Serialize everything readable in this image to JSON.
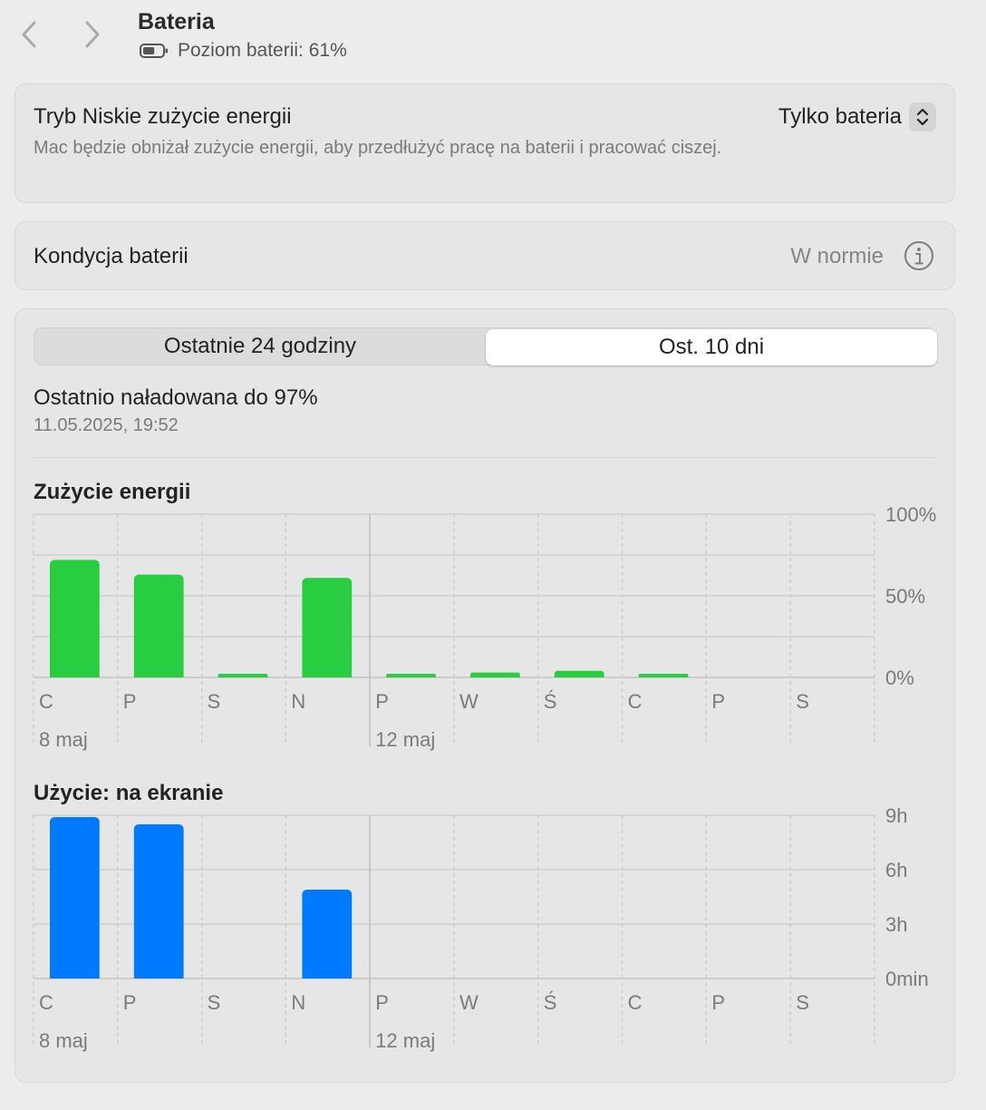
{
  "header": {
    "title": "Bateria",
    "battery_status": "Poziom baterii: 61%",
    "battery_level": 0.61
  },
  "low_power": {
    "title": "Tryb Niskie zużycie energii",
    "description": "Mac będzie obniżał zużycie energii, aby przedłużyć pracę na baterii i pracować ciszej.",
    "selected": "Tylko bateria"
  },
  "battery_health": {
    "label": "Kondycja baterii",
    "value": "W normie"
  },
  "usage": {
    "tabs": [
      "Ostatnie 24 godziny",
      "Ost. 10 dni"
    ],
    "active_tab": 1,
    "last_charged": "Ostatnio naładowana do 97%",
    "last_charged_time": "11.05.2025, 19:52"
  },
  "chart_data": [
    {
      "type": "bar",
      "title": "Zużycie energii",
      "categories": [
        "C",
        "P",
        "S",
        "N",
        "P",
        "W",
        "Ś",
        "C",
        "P",
        "S"
      ],
      "date_labels": [
        {
          "index": 0,
          "label": "8 maj"
        },
        {
          "index": 4,
          "label": "12 maj"
        }
      ],
      "values": [
        72,
        63,
        2,
        61,
        2,
        3,
        4,
        2,
        0,
        0
      ],
      "ylim": [
        0,
        100
      ],
      "ytick_labels": [
        "100%",
        "50%",
        "0%"
      ],
      "color": "#28cd41"
    },
    {
      "type": "bar",
      "title": "Użycie: na ekranie",
      "categories": [
        "C",
        "P",
        "S",
        "N",
        "P",
        "W",
        "Ś",
        "C",
        "P",
        "S"
      ],
      "date_labels": [
        {
          "index": 0,
          "label": "8 maj"
        },
        {
          "index": 4,
          "label": "12 maj"
        }
      ],
      "values": [
        8.9,
        8.5,
        0,
        4.9,
        0,
        0,
        0,
        0,
        0,
        0
      ],
      "ylim": [
        0,
        9
      ],
      "ytick_labels": [
        "9h",
        "6h",
        "3h",
        "0min"
      ],
      "color": "#007aff"
    }
  ]
}
